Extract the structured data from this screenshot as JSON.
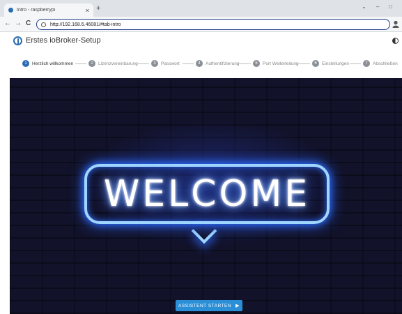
{
  "browser": {
    "tab_title": "Intro - raspberrypi",
    "tab_close": "×",
    "new_tab": "+",
    "back": "←",
    "forward": "→",
    "reload": "C",
    "url": "http://192.168.6.46081/#tab-intro",
    "window_min": "–",
    "window_max": "□",
    "window_menu": "⌄"
  },
  "app": {
    "title": "Erstes ioBroker-Setup"
  },
  "stepper": {
    "steps": [
      {
        "num": "1",
        "label": "Herzlich willkommen",
        "active": true
      },
      {
        "num": "2",
        "label": "Lizenzvereinbarung",
        "active": false
      },
      {
        "num": "3",
        "label": "Passwort",
        "active": false
      },
      {
        "num": "4",
        "label": "Authentifizierung",
        "active": false
      },
      {
        "num": "5",
        "label": "Port Weiterleitung",
        "active": false
      },
      {
        "num": "6",
        "label": "Einstellungen",
        "active": false
      },
      {
        "num": "7",
        "label": "Abschließen",
        "active": false
      }
    ]
  },
  "hero": {
    "text": "WELCOME"
  },
  "start_button": {
    "label": "ASSISTENT STARTEN",
    "icon": "▶"
  },
  "colors": {
    "accent": "#2b6cb0",
    "button": "#2b8fd8"
  }
}
